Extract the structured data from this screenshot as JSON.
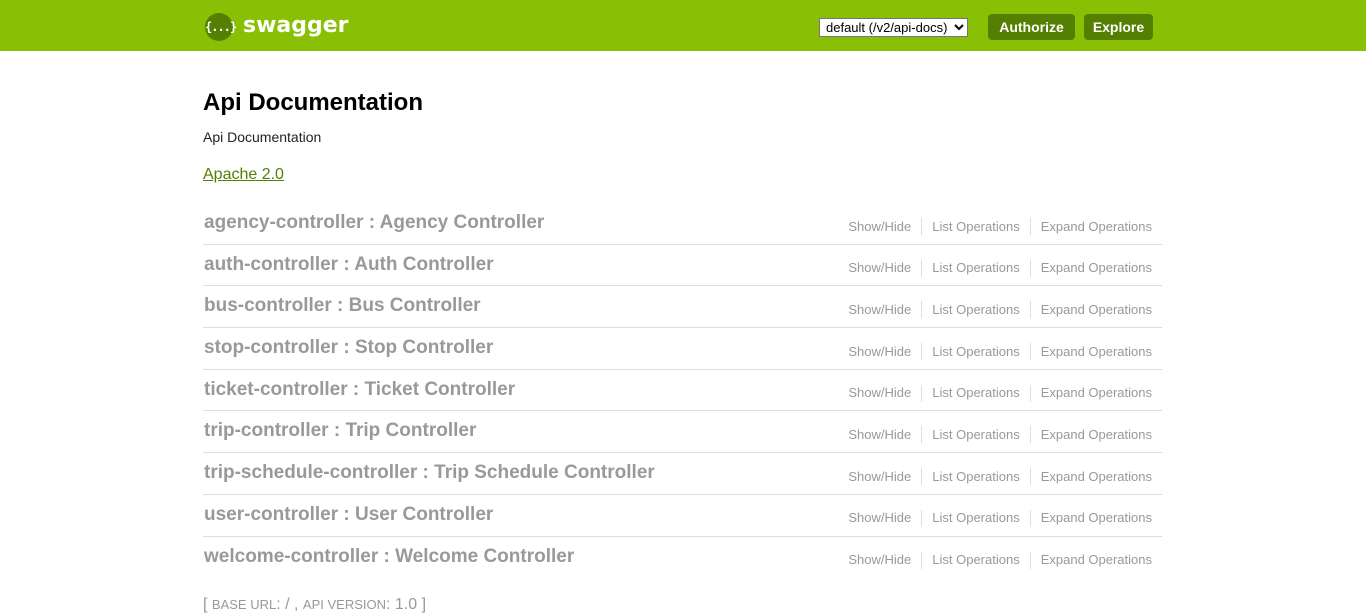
{
  "header": {
    "logo_glyph": "{...}",
    "brand": "swagger",
    "spec_select": {
      "selected": "default (/v2/api-docs)",
      "options": [
        "default (/v2/api-docs)"
      ]
    },
    "authorize_label": "Authorize",
    "explore_label": "Explore",
    "colors": {
      "header_bg": "#89bf04",
      "button_bg": "#547f00"
    }
  },
  "info": {
    "title": "Api Documentation",
    "description": "Api Documentation",
    "license": "Apache 2.0"
  },
  "operation_labels": {
    "show_hide": "Show/Hide",
    "list": "List Operations",
    "expand": "Expand Operations"
  },
  "resources": [
    {
      "title": "agency-controller : Agency Controller"
    },
    {
      "title": "auth-controller : Auth Controller"
    },
    {
      "title": "bus-controller : Bus Controller"
    },
    {
      "title": "stop-controller : Stop Controller"
    },
    {
      "title": "ticket-controller : Ticket Controller"
    },
    {
      "title": "trip-controller : Trip Controller"
    },
    {
      "title": "trip-schedule-controller : Trip Schedule Controller"
    },
    {
      "title": "user-controller : User Controller"
    },
    {
      "title": "welcome-controller : Welcome Controller"
    }
  ],
  "footer": {
    "open_bracket": "[",
    "base_url_label": "BASE URL",
    "base_url_value": ": / ,",
    "api_version_label": "API VERSION",
    "api_version_value": ": 1.0",
    "close_bracket": "]"
  }
}
